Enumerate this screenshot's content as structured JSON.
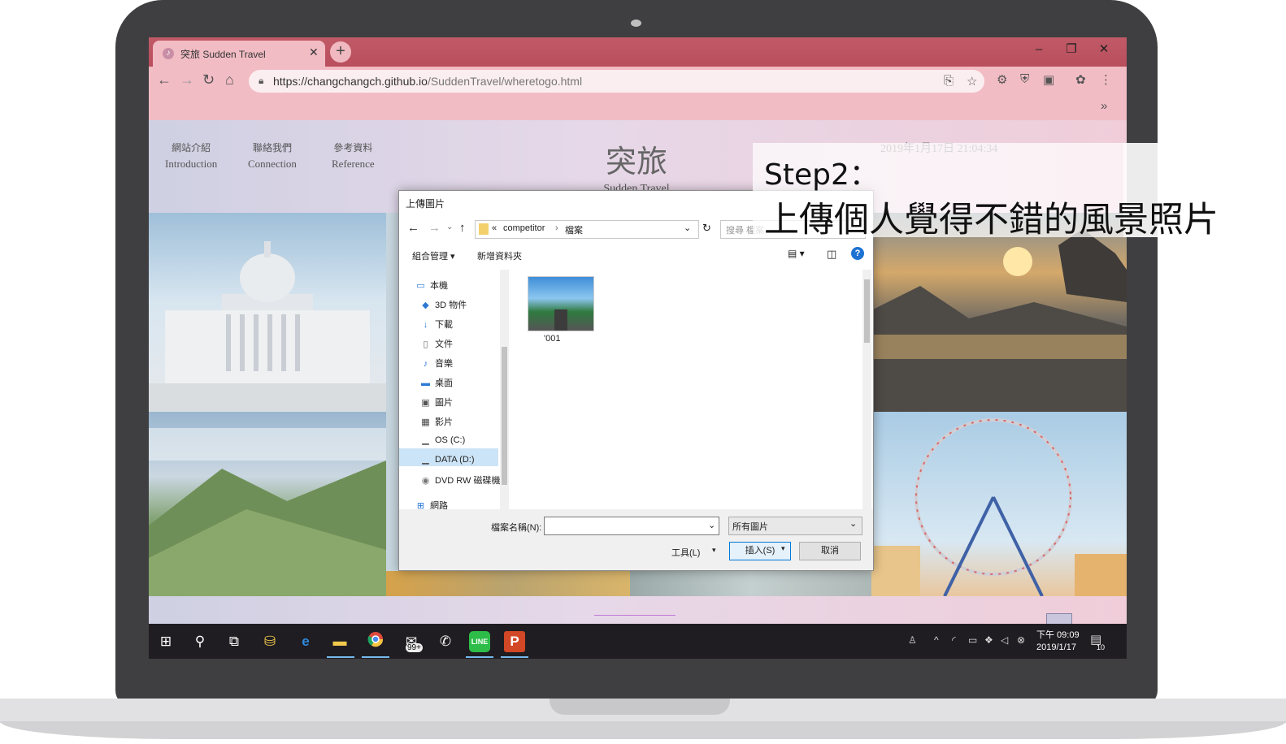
{
  "browser": {
    "tab_title": "突旅 Sudden Travel",
    "url_prefix": "https://",
    "url_host": "changchangch.github.io",
    "url_path": "/SuddenTravel/wheretogo.html",
    "win_minimize": "–",
    "win_restore": "❐",
    "win_close": "✕",
    "new_tab": "+",
    "bookmarks_more": "»"
  },
  "site": {
    "nav": [
      {
        "zh": "網站介紹",
        "en": "Introduction"
      },
      {
        "zh": "聯絡我們",
        "en": "Connection"
      },
      {
        "zh": "參考資料",
        "en": "Reference"
      }
    ],
    "title": "突旅",
    "subtitle": "Sudden Travel",
    "datetime": "2019年1月17日 21:04:34"
  },
  "dialog": {
    "title": "上傳圖片",
    "breadcrumb_root": "«",
    "breadcrumb": [
      "competitor",
      "檔案"
    ],
    "search_placeholder": "搜尋 檔案",
    "organize": "組合管理 ▾",
    "new_folder": "新增資料夾",
    "sidebar": [
      {
        "label": "本機",
        "icon": "computer-icon"
      },
      {
        "label": "3D 物件",
        "icon": "cube-icon"
      },
      {
        "label": "下載",
        "icon": "download-icon"
      },
      {
        "label": "文件",
        "icon": "document-icon"
      },
      {
        "label": "音樂",
        "icon": "music-icon"
      },
      {
        "label": "桌面",
        "icon": "desktop-icon"
      },
      {
        "label": "圖片",
        "icon": "pictures-icon"
      },
      {
        "label": "影片",
        "icon": "video-icon"
      },
      {
        "label": "OS (C:)",
        "icon": "drive-icon"
      },
      {
        "label": "DATA (D:)",
        "icon": "drive-icon"
      },
      {
        "label": "DVD RW 磁碟機",
        "icon": "dvd-icon"
      },
      {
        "label": "網路",
        "icon": "network-icon"
      }
    ],
    "selected_item": "DATA (D:)",
    "files": [
      {
        "name": "'001"
      }
    ],
    "filename_label": "檔案名稱(N):",
    "filename_value": "",
    "filetype": "所有圖片",
    "tools": "工具(L)",
    "insert": "插入(S)",
    "cancel": "取消"
  },
  "overlay": {
    "step": "Step2：",
    "description": "上傳個人覺得不錯的風景照片"
  },
  "taskbar": {
    "mail_badge": "99+",
    "time": "下午 09:09",
    "date": "2019/1/17",
    "notification_count": "10"
  },
  "colors": {
    "tab_strip": "#bd5564",
    "toolbar": "#f2bcc4",
    "taskbar": "#1f1d21",
    "bezel": "#3f3f41"
  }
}
